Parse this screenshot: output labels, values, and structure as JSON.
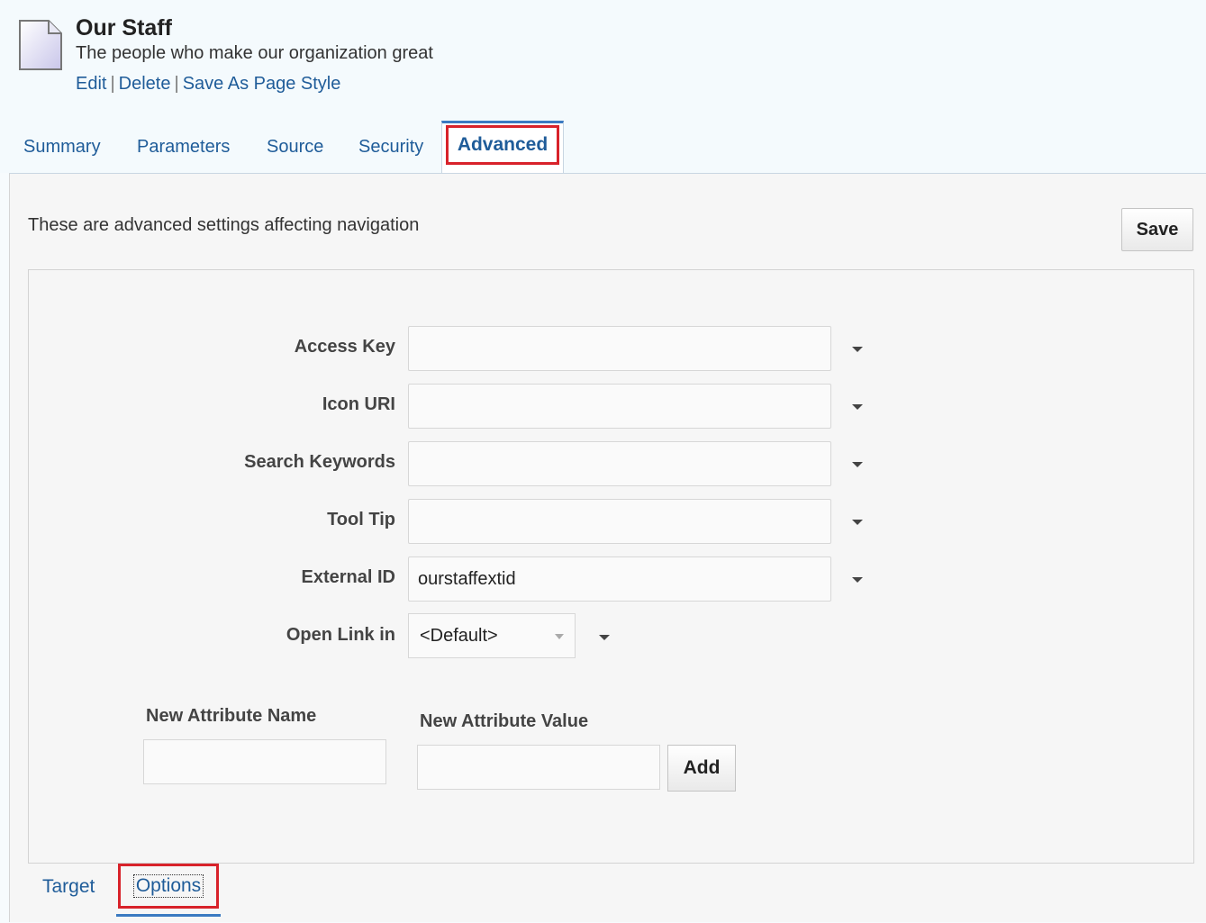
{
  "page": {
    "title": "Our Staff",
    "subtitle": "The people who make our organization great",
    "actions": {
      "edit": "Edit",
      "delete": "Delete",
      "save_style": "Save As Page Style",
      "separator": "|"
    }
  },
  "tabs": [
    {
      "label": "Summary"
    },
    {
      "label": "Parameters"
    },
    {
      "label": "Source"
    },
    {
      "label": "Security"
    },
    {
      "label": "Advanced",
      "active": true
    }
  ],
  "advanced": {
    "intro": "These are advanced settings affecting navigation",
    "save_label": "Save",
    "fields": [
      {
        "label": "Access Key",
        "value": ""
      },
      {
        "label": "Icon URI",
        "value": ""
      },
      {
        "label": "Search Keywords",
        "value": ""
      },
      {
        "label": "Tool Tip",
        "value": ""
      },
      {
        "label": "External ID",
        "value": "ourstaffextid"
      }
    ],
    "open_link": {
      "label": "Open Link in",
      "selected": "<Default>"
    },
    "new_attribute": {
      "name_label": "New Attribute Name",
      "value_label": "New Attribute Value",
      "add_label": "Add"
    }
  },
  "subtabs": [
    {
      "label": "Target"
    },
    {
      "label": "Options",
      "active": true
    }
  ],
  "colors": {
    "link": "#1f5c99",
    "accent_border": "#3b7ac1",
    "highlight": "#d8222a"
  },
  "icons": {
    "page": "document-icon",
    "dropdown": "chevron-down-icon"
  }
}
